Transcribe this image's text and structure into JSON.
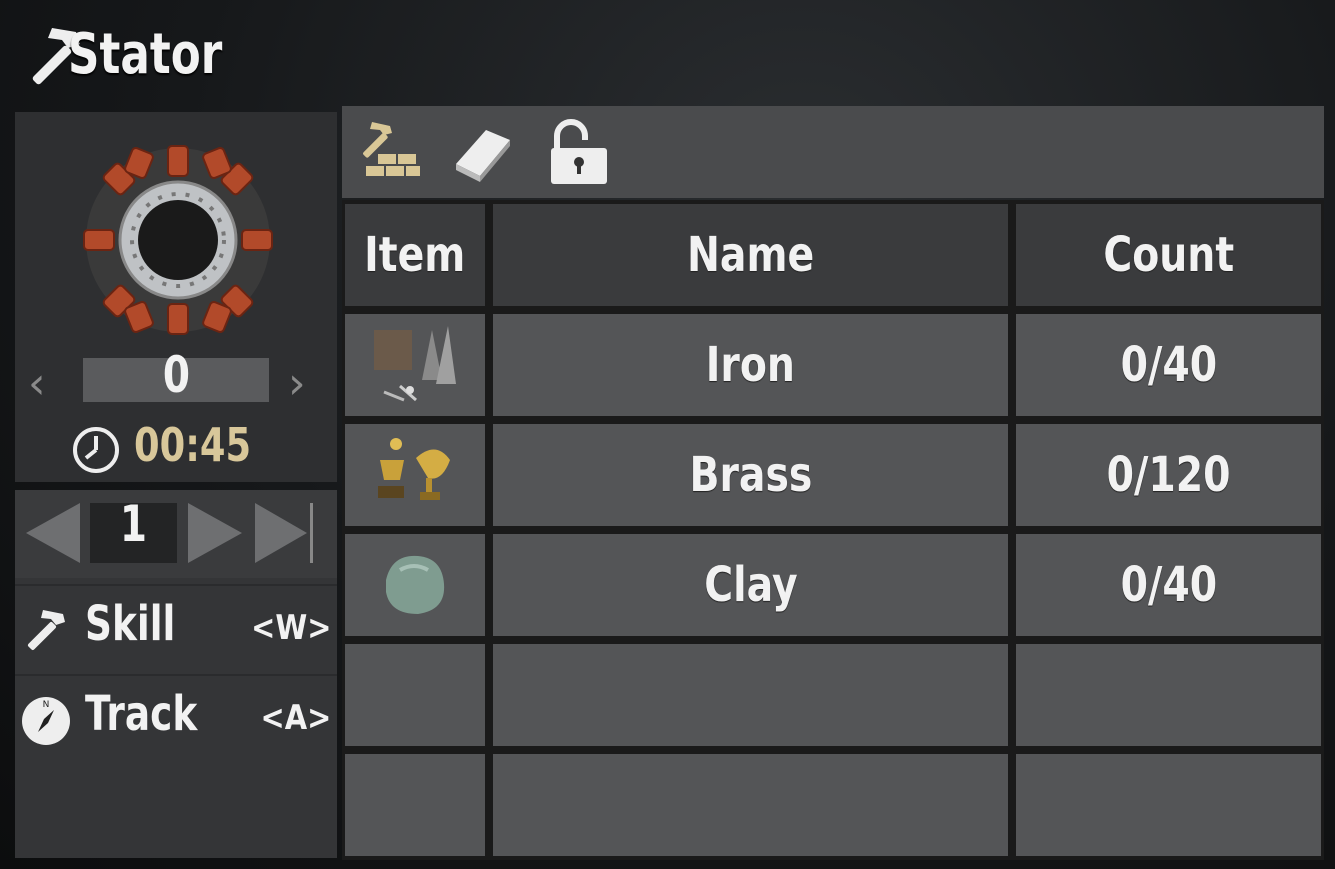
{
  "window": {
    "title": "Stator",
    "title_icon": "hammer-icon"
  },
  "recipe": {
    "craft_count": "0",
    "craft_time": "00:45",
    "time_color": "#d8c79a"
  },
  "quantity": {
    "value": "1"
  },
  "info": {
    "skill_label": "Skill",
    "skill_key": "<W>",
    "track_label": "Track",
    "track_key": "<A>"
  },
  "tabs": [
    {
      "icon": "hammer-bricks-icon",
      "active": true
    },
    {
      "icon": "book-icon",
      "active": false
    },
    {
      "icon": "unlock-icon",
      "active": false
    }
  ],
  "table": {
    "headers": {
      "item": "Item",
      "name": "Name",
      "count": "Count"
    },
    "rows": [
      {
        "icon": "iron-icon",
        "name": "Iron",
        "count": "0/40"
      },
      {
        "icon": "brass-icon",
        "name": "Brass",
        "count": "0/120"
      },
      {
        "icon": "clay-icon",
        "name": "Clay",
        "count": "0/40"
      },
      {
        "icon": "",
        "name": "",
        "count": ""
      },
      {
        "icon": "",
        "name": "",
        "count": ""
      }
    ]
  }
}
